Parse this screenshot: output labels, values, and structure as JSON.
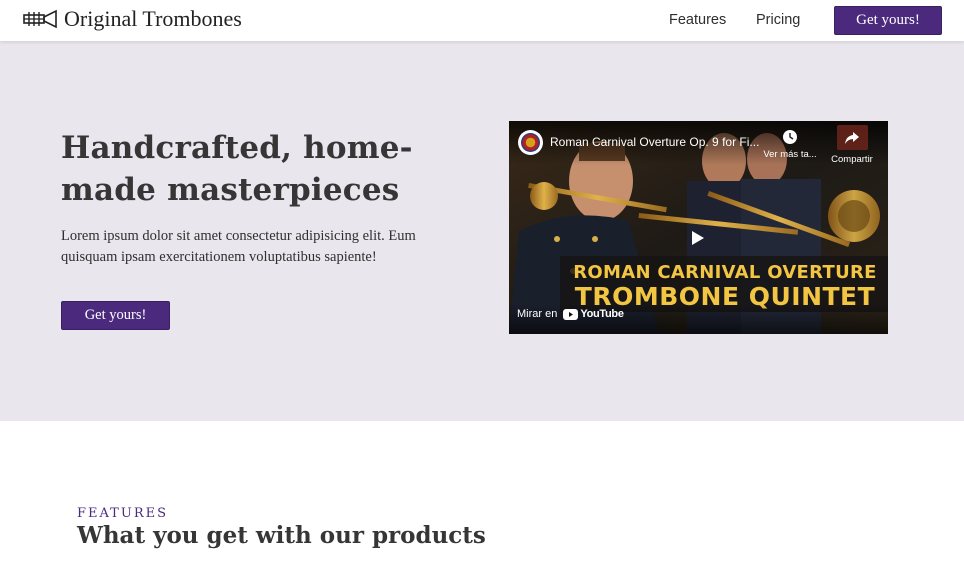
{
  "header": {
    "brand": "Original Trombones",
    "nav": [
      {
        "label": "Features"
      },
      {
        "label": "Pricing"
      }
    ],
    "cta_label": "Get yours!"
  },
  "hero": {
    "title": "Handcrafted, home-made masterpieces",
    "text": "Lorem ipsum dolor sit amet consectetur adipisicing elit. Eum quisquam ipsam exercitationem voluptatibus sapiente!",
    "cta_label": "Get yours!",
    "background_color": "#e9e6ee"
  },
  "video": {
    "title": "Roman Carnival Overture Op. 9 for Fi...",
    "watch_later_label": "Ver más ta...",
    "share_label": "Compartir",
    "banner_line1": "ROMAN CARNIVAL OVERTURE",
    "banner_line2": "TROMBONE QUINTET",
    "watch_on_label": "Mirar en",
    "youtube_label": "YouTube",
    "icons": [
      "watch-later-icon",
      "share-icon",
      "play-icon",
      "youtube-logo"
    ]
  },
  "features": {
    "eyebrow": "FEATURES",
    "title": "What you get with our products"
  },
  "colors": {
    "accent": "#4b2a7e",
    "banner_text": "#f2c542"
  }
}
